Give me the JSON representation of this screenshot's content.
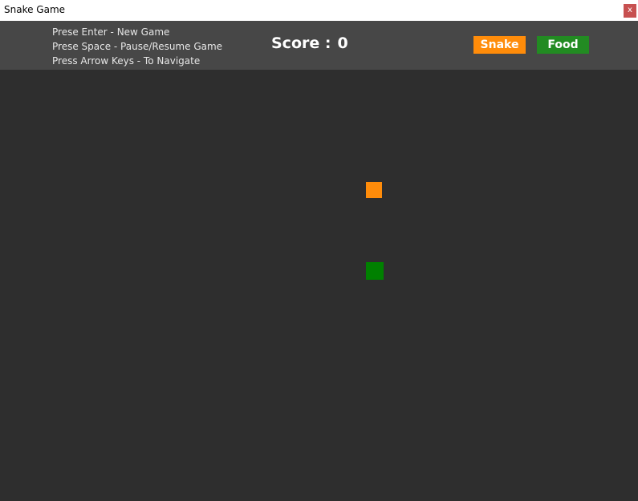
{
  "window": {
    "title": "Snake Game",
    "close_label": "x"
  },
  "header": {
    "instructions": [
      "Prese Enter - New Game",
      "Prese Space - Pause/Resume Game",
      "Press Arrow Keys - To Navigate"
    ],
    "score_label": "Score :",
    "score_value": "0",
    "legend": {
      "snake_label": "Snake",
      "food_label": "Food"
    }
  },
  "colors": {
    "snake": "#ff8c0a",
    "food": "#228b22",
    "food_on_board": "#008000",
    "board": "#2e2e2e",
    "header": "#474747",
    "close": "#c75050"
  },
  "board": {
    "snake_segments": 1,
    "food_items": 1
  }
}
